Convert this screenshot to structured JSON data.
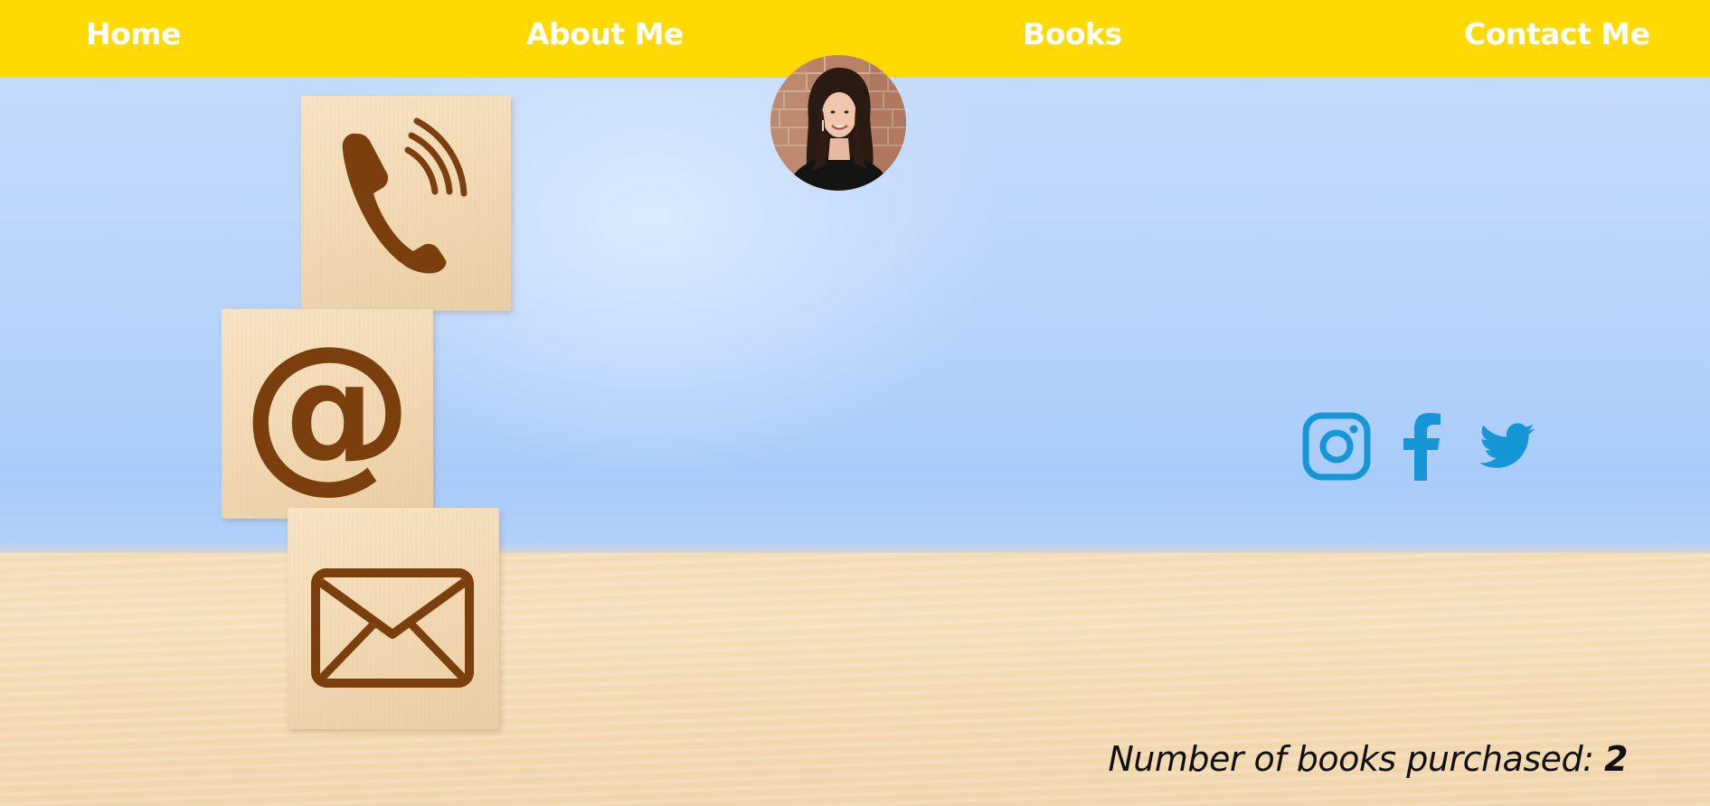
{
  "nav": {
    "home": "Home",
    "about": "About Me",
    "books": "Books",
    "contact": "Contact Me"
  },
  "colors": {
    "navbar": "#ffda00",
    "nav_text": "#ffffff",
    "social": "#1596d6",
    "block_icon": "#7a3f0c"
  },
  "hero": {
    "blocks": [
      "phone-icon",
      "at-sign-icon",
      "envelope-icon"
    ]
  },
  "social": {
    "icons": [
      "instagram-icon",
      "facebook-icon",
      "twitter-icon"
    ]
  },
  "footer": {
    "books_purchased_label": "Number of books purchased:",
    "books_purchased_count": "2"
  }
}
